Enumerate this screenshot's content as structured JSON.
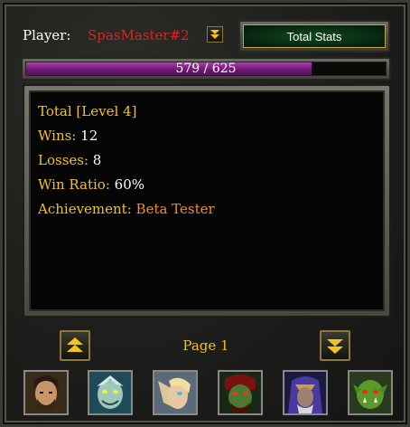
{
  "header": {
    "player_label": "Player:",
    "player_name": "SpasMaster#2",
    "player_name_color": "#e02020",
    "dropdown_icon": "chevron-down-icon",
    "total_stats_label": "Total Stats"
  },
  "xp": {
    "text": "579 / 625",
    "current": 579,
    "max": 625,
    "fraction": 0.7944,
    "fill_color": "#8a2890"
  },
  "stats": {
    "title": "Total",
    "level": "[Level 4]",
    "wins_label": "Wins:",
    "wins_value": "12",
    "losses_label": "Losses:",
    "losses_value": "8",
    "ratio_label": "Win Ratio:",
    "ratio_value": "60%",
    "achievement_label": "Achievement:",
    "achievement_value": "Beta Tester"
  },
  "pager": {
    "up_icon": "double-chevron-up-icon",
    "down_icon": "double-chevron-down-icon",
    "page_label": "Page 1"
  },
  "heroes": [
    {
      "name": "hero-portrait-human-hero",
      "icon": "human-hero-icon"
    },
    {
      "name": "hero-portrait-naga",
      "icon": "naga-icon"
    },
    {
      "name": "hero-portrait-blood-elf",
      "icon": "blood-elf-icon"
    },
    {
      "name": "hero-portrait-orc-warlock",
      "icon": "orc-warlock-icon"
    },
    {
      "name": "hero-portrait-hooded-mage",
      "icon": "hooded-mage-icon"
    },
    {
      "name": "hero-portrait-orc-grunt",
      "icon": "orc-grunt-icon"
    }
  ],
  "colors": {
    "gold_text": "#f2c21f",
    "orange_text": "#ff8a1e",
    "panel_bg": "#050505",
    "button_green": "#0f4a1a"
  }
}
